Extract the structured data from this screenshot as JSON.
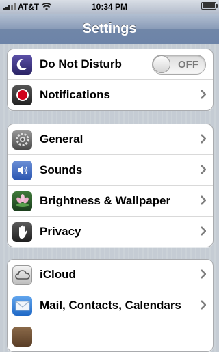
{
  "status_bar": {
    "carrier": "AT&T",
    "time": "10:34 PM",
    "signal_bars": 5,
    "signal_bars_filled": 3,
    "wifi_icon": "wifi-icon",
    "battery_icon": "battery-icon"
  },
  "nav": {
    "title": "Settings"
  },
  "groups": [
    {
      "rows": [
        {
          "label": "Do Not Disturb",
          "icon": "moon-icon",
          "accessory": "toggle",
          "toggle_text": "OFF",
          "toggle_on": false
        },
        {
          "label": "Notifications",
          "icon": "notifications-icon",
          "accessory": "chevron"
        }
      ]
    },
    {
      "rows": [
        {
          "label": "General",
          "icon": "gear-icon",
          "accessory": "chevron"
        },
        {
          "label": "Sounds",
          "icon": "speaker-icon",
          "accessory": "chevron"
        },
        {
          "label": "Brightness & Wallpaper",
          "icon": "flower-icon",
          "accessory": "chevron"
        },
        {
          "label": "Privacy",
          "icon": "hand-icon",
          "accessory": "chevron"
        }
      ]
    },
    {
      "rows": [
        {
          "label": "iCloud",
          "icon": "cloud-icon",
          "accessory": "chevron"
        },
        {
          "label": "Mail, Contacts, Calendars",
          "icon": "envelope-icon",
          "accessory": "chevron"
        }
      ]
    }
  ],
  "colors": {
    "nav_bar": "#6d84a8",
    "background": "#c5ccd4",
    "chevron": "#7f7f7f"
  }
}
